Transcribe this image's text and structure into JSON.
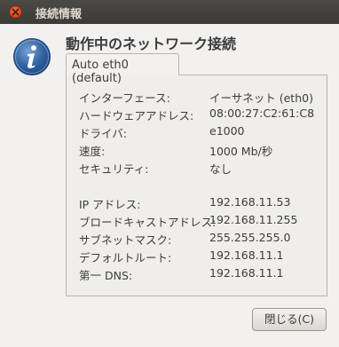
{
  "window": {
    "title": "接続情報"
  },
  "heading": "動作中のネットワーク接続",
  "tab": {
    "label": "Auto eth0 (default)"
  },
  "details": [
    {
      "label": "インターフェース:",
      "value": "イーサネット (eth0)"
    },
    {
      "label": "ハードウェアアドレス:",
      "value": "08:00:27:C2:61:C8"
    },
    {
      "label": "ドライバ:",
      "value": "e1000"
    },
    {
      "label": "速度:",
      "value": "1000 Mb/秒"
    },
    {
      "label": "セキュリティ:",
      "value": "なし"
    },
    {
      "label": "IP アドレス:",
      "value": "192.168.11.53"
    },
    {
      "label": "ブロードキャストアドレス:",
      "value": "192.168.11.255"
    },
    {
      "label": "サブネットマスク:",
      "value": "255.255.255.0"
    },
    {
      "label": "デフォルトルート:",
      "value": "192.168.11.1"
    },
    {
      "label": "第一 DNS:",
      "value": "192.168.11.1"
    }
  ],
  "buttons": {
    "close": "閉じる(C)"
  },
  "colors": {
    "titlebar": "#3c3b37",
    "close_button": "#e0471b",
    "info_icon": "#3465a4",
    "background": "#f2f1f0"
  }
}
